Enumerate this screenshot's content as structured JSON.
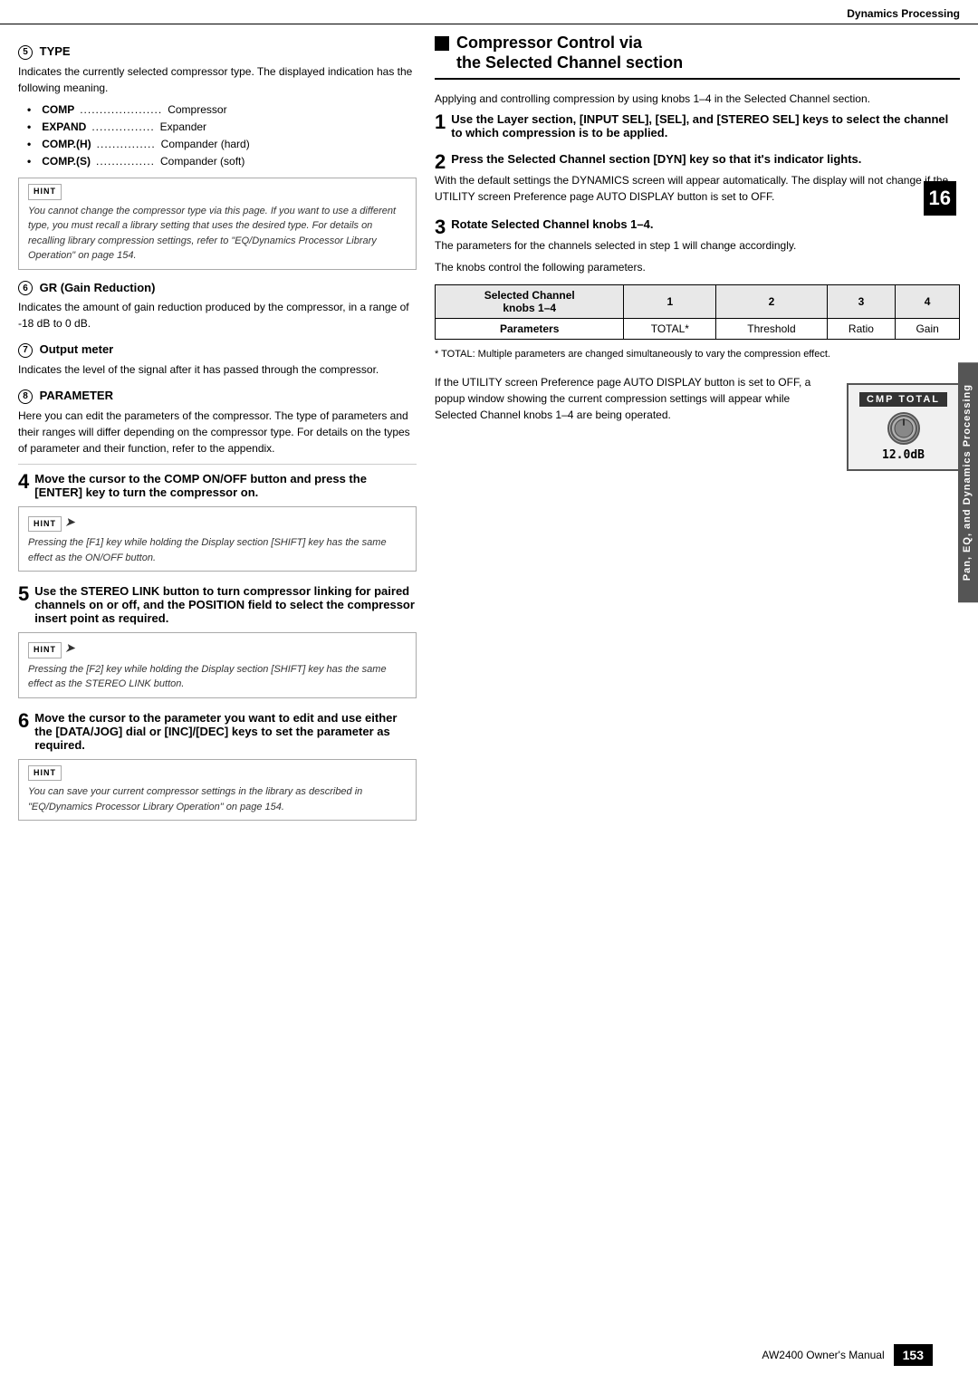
{
  "header": {
    "title": "Dynamics Processing"
  },
  "footer": {
    "manual_name": "AW2400 Owner's Manual",
    "page_number": "153"
  },
  "side_tab": {
    "label": "Pan, EQ, and Dynamics Processing"
  },
  "chapter_number": "16",
  "left_col": {
    "type_section": {
      "num": "5",
      "heading": "TYPE",
      "description": "Indicates the currently selected compressor type. The displayed indication has the following meaning.",
      "items": [
        {
          "label": "COMP",
          "dots": "...................",
          "value": "Compressor"
        },
        {
          "label": "EXPAND",
          "dots": "...............",
          "value": "Expander"
        },
        {
          "label": "COMP.(H)",
          "dots": "...............",
          "value": "Compander (hard)"
        },
        {
          "label": "COMP.(S)",
          "dots": "...............",
          "value": "Compander (soft)"
        }
      ],
      "hint": {
        "text": "You cannot change the compressor type via this page. If you want to use a different type, you must recall a library setting that uses the desired type. For details on recalling library compression settings, refer to \"EQ/Dynamics Processor Library Operation\" on page 154."
      }
    },
    "gr_section": {
      "num": "6",
      "heading": "GR (Gain Reduction)",
      "description": "Indicates the amount of gain reduction produced by the compressor, in a range of -18 dB to 0 dB."
    },
    "output_section": {
      "num": "7",
      "heading": "Output meter",
      "description": "Indicates the level of the signal after it has passed through the compressor."
    },
    "param_section": {
      "num": "8",
      "heading": "PARAMETER",
      "description": "Here you can edit the parameters of the compressor. The type of parameters and their ranges will differ depending on the compressor type. For details on the types of parameter and their function, refer to the appendix."
    },
    "step4": {
      "num": "4",
      "heading": "Move the cursor to the COMP ON/OFF button and press the [ENTER] key to turn the compressor on.",
      "hint": {
        "text": "Pressing the [F1] key while holding the Display section [SHIFT] key has the same effect as the ON/OFF button."
      }
    },
    "step5": {
      "num": "5",
      "heading": "Use the STEREO LINK button to turn compressor linking for paired channels on or off, and the POSITION field to select the compressor insert point as required.",
      "hint": {
        "text": "Pressing the [F2] key while holding the Display section [SHIFT] key has the same effect as the STEREO LINK button."
      }
    },
    "step6": {
      "num": "6",
      "heading": "Move the cursor to the parameter you want to edit and use either the [DATA/JOG] dial or [INC]/[DEC] keys to set the parameter as required.",
      "hint": {
        "text": "You can save your current compressor settings in the library as described in \"EQ/Dynamics Processor Library Operation\" on page 154."
      }
    }
  },
  "right_col": {
    "comp_title_line1": "Compressor Control via",
    "comp_title_line2": "the Selected Channel section",
    "intro_text": "Applying and controlling compression by using knobs 1–4 in the Selected Channel section.",
    "step1": {
      "num": "1",
      "heading": "Use the Layer section, [INPUT SEL], [SEL], and [STEREO SEL] keys to select the channel to which compression is to be applied."
    },
    "step2": {
      "num": "2",
      "heading": "Press the Selected Channel section [DYN] key so that it's indicator lights.",
      "body": "With the default settings the DYNAMICS screen will appear automatically. The display will not change if the UTILITY screen Preference page AUTO DISPLAY button is set to OFF."
    },
    "step3": {
      "num": "3",
      "heading": "Rotate Selected Channel knobs 1–4.",
      "body1": "The parameters for the channels selected in step 1 will change accordingly.",
      "body2": "The knobs control the following parameters.",
      "table": {
        "header_row": [
          "Selected Channel knobs 1–4",
          "1",
          "2",
          "3",
          "4"
        ],
        "data_row": [
          "Parameters",
          "TOTAL*",
          "Threshold",
          "Ratio",
          "Gain"
        ]
      },
      "footnote": "* TOTAL:  Multiple parameters are changed simultaneously to vary the compression effect."
    },
    "popup_section": {
      "description": "If the UTILITY screen Preference page AUTO DISPLAY button is set to OFF, a popup window showing the current compression settings will appear while Selected Channel knobs 1–4 are being operated.",
      "display": {
        "header": "CMP TOTAL",
        "value": "12.0dB"
      }
    }
  }
}
